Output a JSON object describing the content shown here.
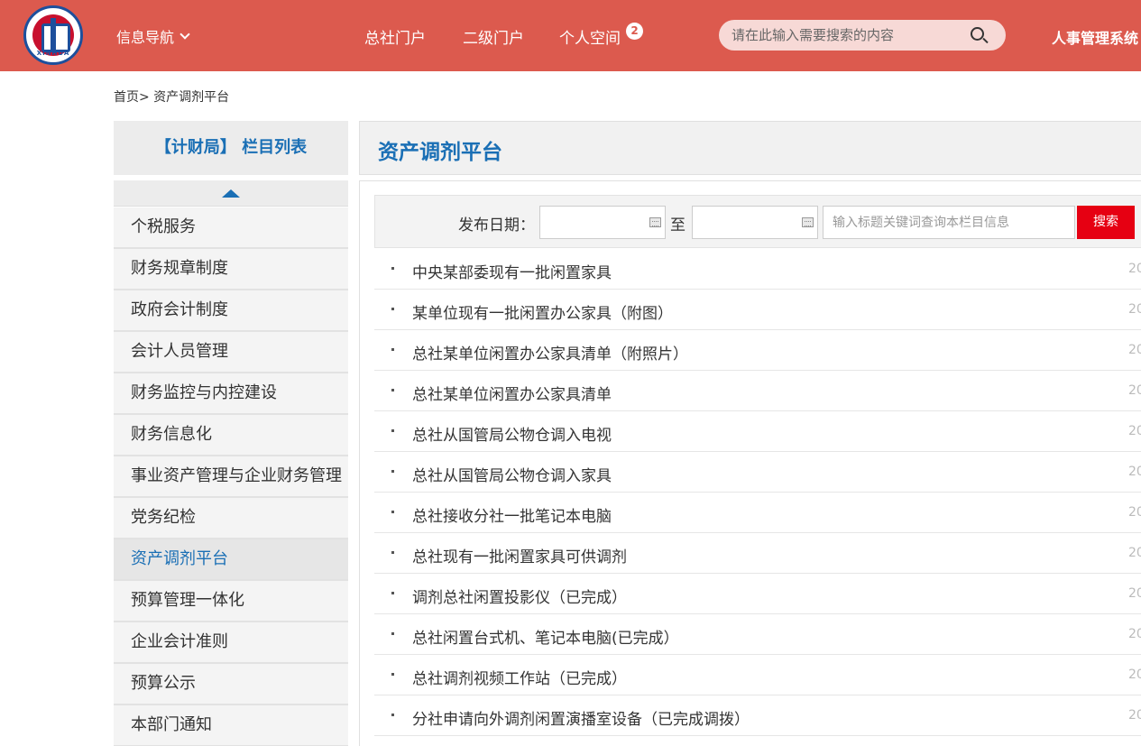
{
  "header": {
    "logo_text": "XINHUA",
    "nav_info_label": "信息导航",
    "nav_links": [
      "总社门户",
      "二级门户",
      "个人空间"
    ],
    "personal_badge": "2",
    "search_placeholder": "请在此输入需要搜索的内容",
    "hr_system": "人事管理系统"
  },
  "breadcrumb": "首页> 资产调剂平台",
  "sidebar": {
    "title": "【计财局】 栏目列表",
    "items": [
      {
        "label": "个税服务"
      },
      {
        "label": "财务规章制度"
      },
      {
        "label": "政府会计制度"
      },
      {
        "label": "会计人员管理"
      },
      {
        "label": "财务监控与内控建设"
      },
      {
        "label": "财务信息化"
      },
      {
        "label": "事业资产管理与企业财务管理"
      },
      {
        "label": "党务纪检"
      },
      {
        "label": "资产调剂平台"
      },
      {
        "label": "预算管理一体化"
      },
      {
        "label": "企业会计准则"
      },
      {
        "label": "预算公示"
      },
      {
        "label": "本部门通知"
      }
    ],
    "active_index": 8
  },
  "main": {
    "title": "资产调剂平台",
    "filter": {
      "date_label": "发布日期：",
      "to_label": "至",
      "start_value": "",
      "end_value": "",
      "keyword_placeholder": "输入标题关键词查询本栏目信息",
      "search_label": "搜索"
    },
    "articles": [
      {
        "title": "中央某部委现有一批闲置家具",
        "date": "20"
      },
      {
        "title": "某单位现有一批闲置办公家具（附图）",
        "date": "20"
      },
      {
        "title": "总社某单位闲置办公家具清单（附照片）",
        "date": "20"
      },
      {
        "title": "总社某单位闲置办公家具清单",
        "date": "20"
      },
      {
        "title": "总社从国管局公物仓调入电视",
        "date": "20"
      },
      {
        "title": "总社从国管局公物仓调入家具",
        "date": "20"
      },
      {
        "title": "总社接收分社一批笔记本电脑",
        "date": "20"
      },
      {
        "title": "总社现有一批闲置家具可供调剂",
        "date": "20"
      },
      {
        "title": "调剂总社闲置投影仪（已完成）",
        "date": "20"
      },
      {
        "title": "总社闲置台式机、笔记本电脑(已完成）",
        "date": "20"
      },
      {
        "title": "总社调剂视频工作站（已完成）",
        "date": "20"
      },
      {
        "title": "分社申请向外调剂闲置演播室设备（已完成调拨）",
        "date": "20"
      }
    ]
  },
  "colors": {
    "header_bg": "#dc5a4e",
    "accent_blue": "#1a6fb5",
    "search_button": "#e60012"
  }
}
